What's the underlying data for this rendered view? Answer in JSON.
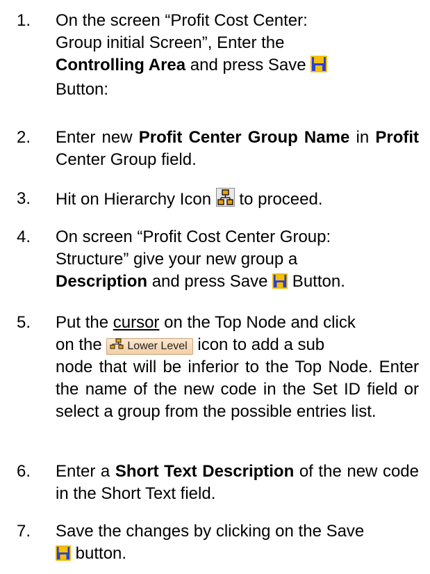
{
  "steps": [
    {
      "number": "1.",
      "line1": "On the screen “Profit Cost Center:",
      "line2": "Group initial Screen”, Enter the",
      "bold1": "Controlling Area",
      "mid1": " and press Save ",
      "line4": "Button:",
      "icons": [
        "save-icon"
      ]
    },
    {
      "number": "2.",
      "pre": "Enter new ",
      "bold1": "Profit Center Group Name",
      "mid": " in ",
      "bold2": "Profit",
      "post": " Center Group field."
    },
    {
      "number": "3.",
      "pre": "Hit on Hierarchy Icon ",
      "post": " to proceed.",
      "icons": [
        "hierarchy-icon"
      ]
    },
    {
      "number": "4.",
      "line1": "On screen “Profit Cost Center Group:",
      "line2": "Structure” give your new group a",
      "bold1": "Description",
      "post": " and press Save ",
      "post2": " Button.",
      "icons": [
        "save-icon"
      ]
    },
    {
      "number": "5.",
      "line1a": "Put the ",
      "cursor_word": "cursor",
      "line1b": " on the Top Node and click",
      "line2a": "on the ",
      "button_label": "Lower Level",
      "line2b": " icon to add a sub",
      "rest": "node that will be inferior to the Top Node. Enter the name of the new code in the Set ID field or select a group from the possible entries list.",
      "icons": [
        "lower-level-icon"
      ]
    },
    {
      "number": "6.",
      "pre": "Enter a ",
      "bold1": "Short Text Description",
      "post": " of the new code in the Short Text field."
    },
    {
      "number": "7.",
      "line1": "Save the changes by clicking on the Save",
      "post": " button.",
      "icons": [
        "save-icon"
      ]
    }
  ],
  "colors": {
    "save_icon_body": "#2a3fd8",
    "save_icon_bg": "#f4c000",
    "button_bg": "#f6d9b4"
  }
}
